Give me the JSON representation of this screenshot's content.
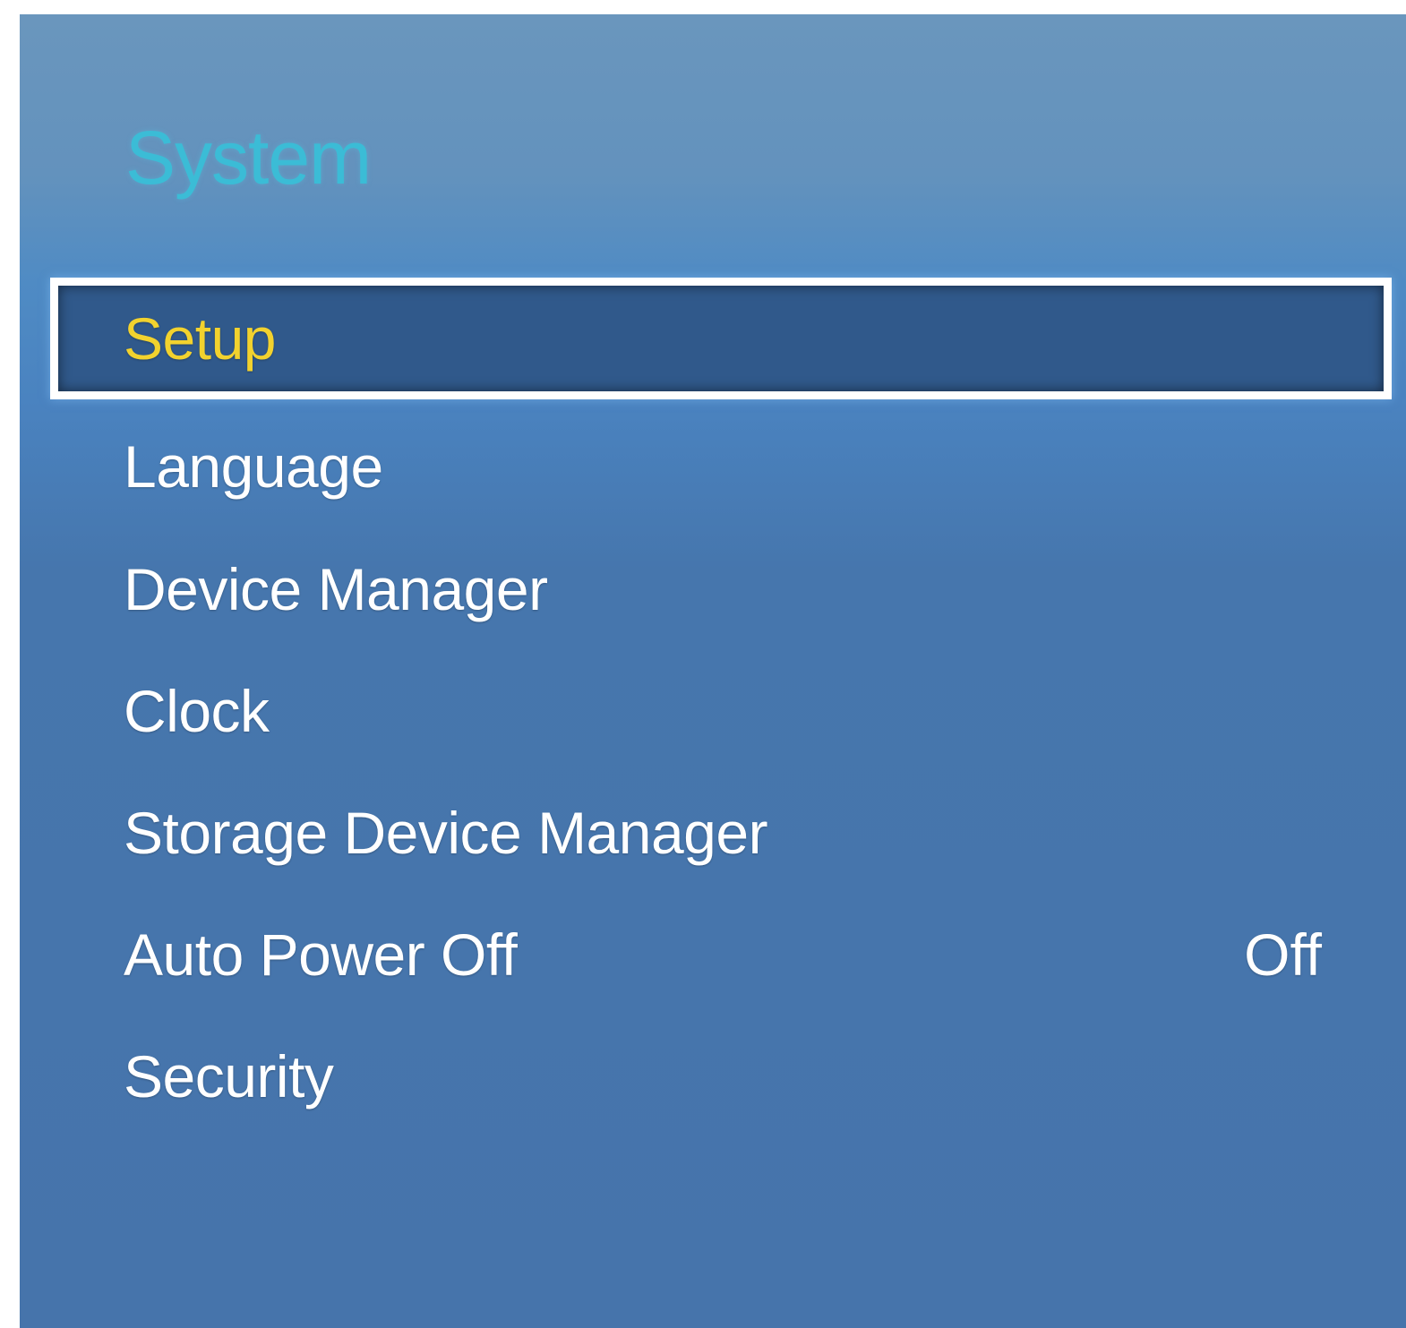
{
  "menu": {
    "title": "System",
    "items": [
      {
        "label": "Setup",
        "value": "",
        "selected": true
      },
      {
        "label": "Language",
        "value": ""
      },
      {
        "label": "Device Manager",
        "value": ""
      },
      {
        "label": "Clock",
        "value": ""
      },
      {
        "label": "Storage Device Manager",
        "value": ""
      },
      {
        "label": "Auto Power Off",
        "value": "Off"
      },
      {
        "label": "Security",
        "value": ""
      }
    ]
  },
  "colors": {
    "title": "#3bbcd6",
    "selected_text": "#f2d22e",
    "selected_bg": "#30598b",
    "panel_bg": "#4674ab",
    "item_text": "#ffffff"
  }
}
